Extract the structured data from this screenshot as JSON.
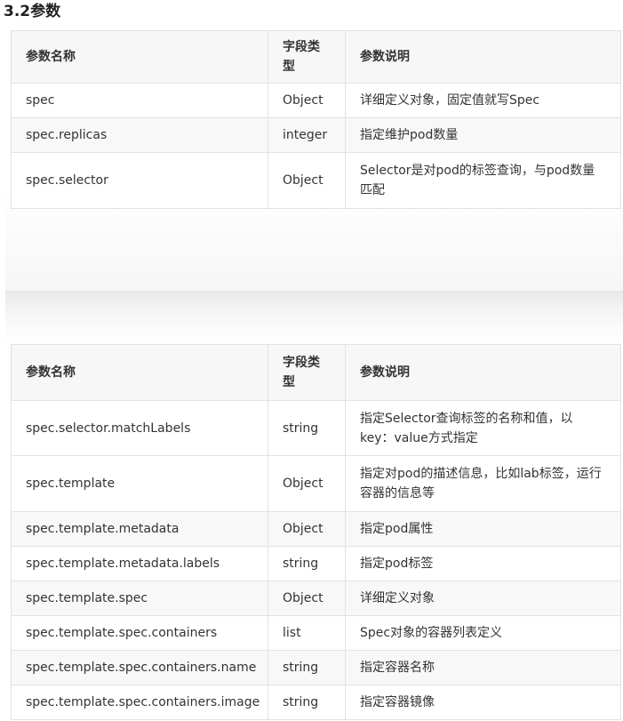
{
  "title": "3.2参数",
  "columns": {
    "name": "参数名称",
    "type": "字段类型",
    "desc": "参数说明"
  },
  "table1": {
    "rows": [
      {
        "name": "spec",
        "type": "Object",
        "desc": "详细定义对象，固定值就写Spec"
      },
      {
        "name": "spec.replicas",
        "type": "integer",
        "desc": "指定维护pod数量"
      },
      {
        "name": "spec.selector",
        "type": "Object",
        "desc": "Selector是对pod的标签查询，与pod数量匹配"
      }
    ]
  },
  "table2": {
    "rows": [
      {
        "name": "spec.selector.matchLabels",
        "type": "string",
        "desc": "指定Selector查询标签的名称和值，以key：value方式指定"
      },
      {
        "name": "spec.template",
        "type": "Object",
        "desc": "指定对pod的描述信息，比如lab标签，运行容器的信息等"
      },
      {
        "name": "spec.template.metadata",
        "type": "Object",
        "desc": "指定pod属性"
      },
      {
        "name": "spec.template.metadata.labels",
        "type": "string",
        "desc": "指定pod标签"
      },
      {
        "name": "spec.template.spec",
        "type": "Object",
        "desc": "详细定义对象"
      },
      {
        "name": "spec.template.spec.containers",
        "type": "list",
        "desc": "Spec对象的容器列表定义"
      },
      {
        "name": "spec.template.spec.containers.name",
        "type": "string",
        "desc": "指定容器名称"
      },
      {
        "name": "spec.template.spec.containers.image",
        "type": "string",
        "desc": "指定容器镜像"
      }
    ]
  }
}
